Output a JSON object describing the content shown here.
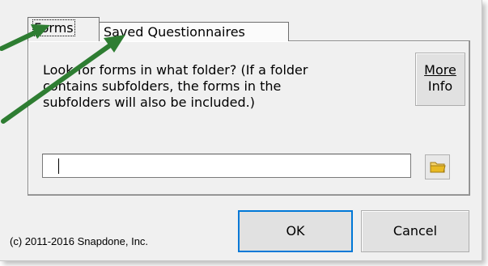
{
  "tabs": [
    {
      "label": "Forms",
      "active": true
    },
    {
      "label": "Saved Questionnaires",
      "active": false
    }
  ],
  "prompt": {
    "text": "Look for forms in what folder?  (If a folder\ncontains subfolders, the forms in the\nsubfolders will also be included.)"
  },
  "more_info": {
    "line1": "More",
    "line2": "Info"
  },
  "folder_path": {
    "value": ""
  },
  "buttons": {
    "ok": "OK",
    "cancel": "Cancel"
  },
  "footer": {
    "copyright": "(c) 2011-2016 Snapdone, Inc."
  },
  "colors": {
    "annotation_arrow": "#2e7d32",
    "dialog_bg": "#f0f0f0",
    "ok_focus_border": "#0078d7",
    "folder_icon": "#e8b923"
  },
  "icons": {
    "browse": "folder-icon"
  }
}
